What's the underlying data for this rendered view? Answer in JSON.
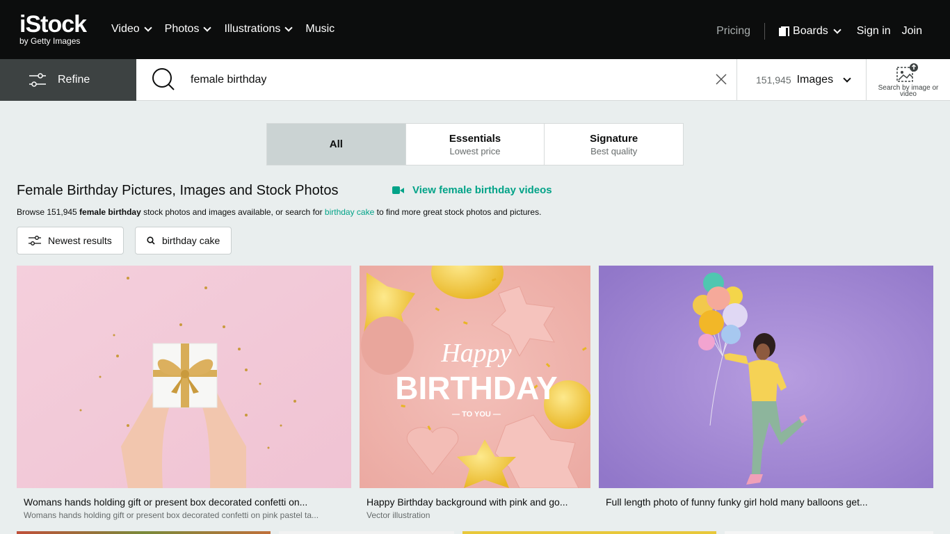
{
  "brand": {
    "logo": "iStock",
    "tagline": "by Getty Images"
  },
  "nav": {
    "left": [
      {
        "label": "Video",
        "has_menu": true
      },
      {
        "label": "Photos",
        "has_menu": true
      },
      {
        "label": "Illustrations",
        "has_menu": true
      },
      {
        "label": "Music",
        "has_menu": false
      }
    ],
    "pricing": "Pricing",
    "boards": "Boards",
    "sign_in": "Sign in",
    "join": "Join"
  },
  "search": {
    "refine_label": "Refine",
    "query": "female birthday",
    "result_count": "151,945",
    "media_type": "Images",
    "visual_search_label": "Search by image or video"
  },
  "tabs": [
    {
      "title": "All",
      "subtitle": "",
      "active": true
    },
    {
      "title": "Essentials",
      "subtitle": "Lowest price",
      "active": false
    },
    {
      "title": "Signature",
      "subtitle": "Best quality",
      "active": false
    }
  ],
  "heading": {
    "title": "Female Birthday Pictures, Images and Stock Photos",
    "video_link": "View female birthday videos",
    "browse_prefix": "Browse 151,945 ",
    "browse_bold": "female birthday",
    "browse_middle": " stock photos and images available, or search for ",
    "browse_link": "birthday cake",
    "browse_suffix": " to find more great stock photos and pictures."
  },
  "filters": [
    {
      "label": "Newest results",
      "icon": "sliders-icon"
    },
    {
      "label": "birthday cake",
      "icon": "search-icon"
    }
  ],
  "results": [
    {
      "title": "Womans hands holding gift or present box decorated confetti on...",
      "subtitle": "Womans hands holding gift or present box decorated confetti on pink pastel ta..."
    },
    {
      "title": "Happy Birthday background with pink and go...",
      "subtitle": "Vector illustration"
    },
    {
      "title": "Full length photo of funny funky girl hold many balloons get...",
      "subtitle": ""
    }
  ],
  "artwork": {
    "happy": "Happy",
    "birthday": "BIRTHDAY",
    "to_you": "— TO YOU —"
  },
  "colors": {
    "topbar": "#0c0d0d",
    "accent": "#02a388",
    "refine_bg": "#3d4242",
    "page_bg": "#e9eeee",
    "tab_active": "#cbd3d3"
  }
}
